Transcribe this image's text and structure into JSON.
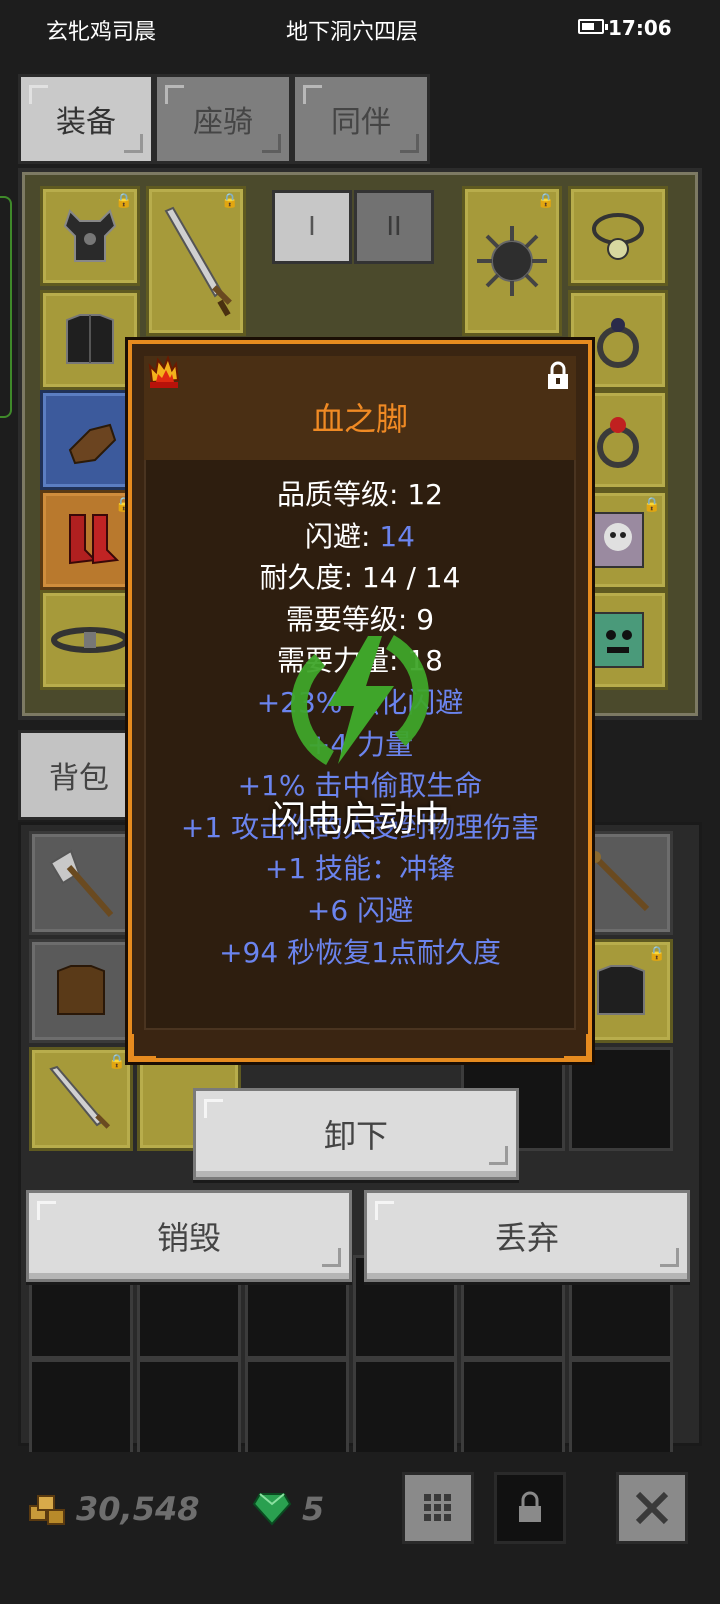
{
  "status_bar": {
    "player_name": "玄牝鸡司晨",
    "location": "地下洞穴四层",
    "time": "17:06"
  },
  "tabs": [
    {
      "label": "装备",
      "active": true
    },
    {
      "label": "座骑",
      "active": false
    },
    {
      "label": "同伴",
      "active": false
    }
  ],
  "equip_pages": [
    "I",
    "II"
  ],
  "backpack_tab": {
    "label": "背包"
  },
  "tooltip": {
    "title": "血之脚",
    "lines": [
      {
        "label": "品质等级: ",
        "value": "12",
        "style": "white"
      },
      {
        "label": "闪避: ",
        "value": "14",
        "style": "white-blue"
      },
      {
        "label": "耐久度: ",
        "value": "14 / 14",
        "style": "white"
      },
      {
        "label": "需要等级: ",
        "value": "9",
        "style": "white"
      },
      {
        "label": "需要力量: ",
        "value": "18",
        "style": "white"
      },
      {
        "label": "+23% 强化闪避",
        "value": "",
        "style": "blue"
      },
      {
        "label": "+4 力量",
        "value": "",
        "style": "blue"
      },
      {
        "label": "+1% 击中偷取生命",
        "value": "",
        "style": "blue"
      },
      {
        "label": "+1 攻击你的人受到物理伤害",
        "value": "",
        "style": "blue"
      },
      {
        "label": "+1 技能：冲锋",
        "value": "",
        "style": "blue"
      },
      {
        "label": "+6 闪避",
        "value": "",
        "style": "blue"
      },
      {
        "label": "+94 秒恢复1点耐久度",
        "value": "",
        "style": "blue"
      }
    ],
    "title_color": "#f08a24",
    "stat_color": "#6b84ee"
  },
  "overlay": {
    "text": "闪电启动中",
    "icon": "lightning-bolt-icon",
    "color": "#3fa52a"
  },
  "actions": {
    "unequip_label": "卸下",
    "destroy_label": "销毁",
    "drop_label": "丢弃"
  },
  "currency": {
    "gold": "30,548",
    "gems": "5"
  },
  "toolbar_icons": [
    "grid-icon",
    "lock-icon",
    "close-icon"
  ]
}
